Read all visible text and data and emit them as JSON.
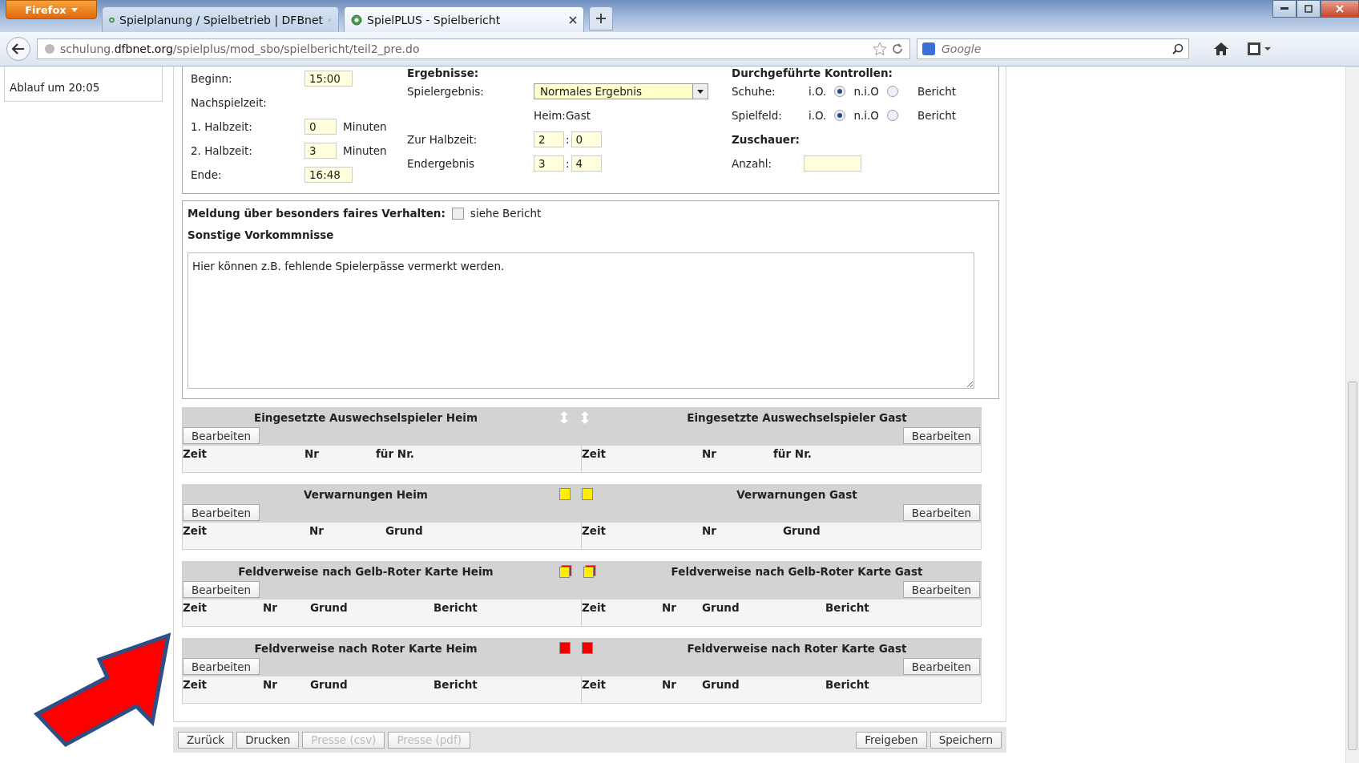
{
  "browser": {
    "menu_button": "Firefox",
    "tabs": [
      {
        "title": "Spielplanung / Spielbetrieb | DFBnet",
        "selected": false
      },
      {
        "title": "SpielPLUS - Spielbericht",
        "selected": true
      }
    ],
    "url_host": "schulung.",
    "url_domain": "dfbnet.org",
    "url_path": "/spielplus/mod_sbo/spielbericht/teil2_pre.do",
    "search_placeholder": "Google"
  },
  "sidebar": {
    "items": [
      "Ablauf um 20:05"
    ]
  },
  "times": [
    {
      "kind": "field",
      "label": "Beginn:",
      "value": "15:00"
    },
    {
      "kind": "label",
      "label": "Nachspielzeit:"
    },
    {
      "kind": "minutes",
      "label": "1. Halbzeit:",
      "value": "0",
      "unit": "Minuten"
    },
    {
      "kind": "minutes",
      "label": "2. Halbzeit:",
      "value": "3",
      "unit": "Minuten"
    },
    {
      "kind": "field",
      "label": "Ende:",
      "value": "16:48"
    }
  ],
  "results": {
    "heading": "Ergebnisse:",
    "result_label": "Spielergebnis:",
    "result_value": "Normales Ergebnis",
    "score_caption": "Heim:Gast",
    "scores": [
      {
        "label": "Zur Halbzeit:",
        "home": "2",
        "separator": ":",
        "guest": "0"
      },
      {
        "label": "Endergebnis",
        "home": "3",
        "separator": ":",
        "guest": "4"
      }
    ]
  },
  "checks": {
    "heading": "Durchgeführte Kontrollen:",
    "rows": [
      {
        "label": "Schuhe:",
        "options": [
          {
            "label": "i.O.",
            "selected": true
          },
          {
            "label": "n.i.O",
            "selected": false
          }
        ],
        "report": "Bericht"
      },
      {
        "label": "Spielfeld:",
        "options": [
          {
            "label": "i.O.",
            "selected": true
          },
          {
            "label": "n.i.O",
            "selected": false
          }
        ],
        "report": "Bericht"
      }
    ],
    "spectators_heading": "Zuschauer:",
    "count_label": "Anzahl:"
  },
  "fair_play": {
    "label": "Meldung über besonders faires Verhalten:",
    "checked": false,
    "checkbox_label": "siehe Bericht"
  },
  "incidents": {
    "heading": "Sonstige Vorkommnisse",
    "text": "Hier können z.B. fehlende Spielerpässe vermerkt werden."
  },
  "sections": [
    {
      "kind": "substitution",
      "home_title": "Eingesetzte Auswechselspieler Heim",
      "guest_title": "Eingesetzte Auswechselspieler Gast",
      "home_button": "Bearbeiten",
      "guest_button": "Bearbeiten",
      "home_columns": [
        "Zeit",
        "Nr",
        "für Nr."
      ],
      "guest_columns": [
        "Zeit",
        "Nr",
        "für Nr."
      ]
    },
    {
      "kind": "yellow",
      "home_title": "Verwarnungen Heim",
      "guest_title": "Verwarnungen Gast",
      "home_button": "Bearbeiten",
      "guest_button": "Bearbeiten",
      "home_columns": [
        "Zeit",
        "Nr",
        "Grund"
      ],
      "guest_columns": [
        "Zeit",
        "Nr",
        "Grund"
      ]
    },
    {
      "kind": "yellowred",
      "home_title": "Feldverweise nach Gelb-Roter Karte Heim",
      "guest_title": "Feldverweise nach Gelb-Roter Karte Gast",
      "home_button": "Bearbeiten",
      "guest_button": "Bearbeiten",
      "home_columns": [
        "Zeit",
        "Nr",
        "Grund",
        "Bericht"
      ],
      "guest_columns": [
        "Zeit",
        "Nr",
        "Grund",
        "Bericht"
      ]
    },
    {
      "kind": "red",
      "home_title": "Feldverweise nach Roter Karte Heim",
      "guest_title": "Feldverweise nach Roter Karte Gast",
      "home_button": "Bearbeiten",
      "guest_button": "Bearbeiten",
      "home_columns": [
        "Zeit",
        "Nr",
        "Grund",
        "Bericht"
      ],
      "guest_columns": [
        "Zeit",
        "Nr",
        "Grund",
        "Bericht"
      ]
    }
  ],
  "footer": {
    "left": [
      {
        "label": "Zurück",
        "disabled": false
      },
      {
        "label": "Drucken",
        "disabled": false
      },
      {
        "label": "Presse (csv)",
        "disabled": true
      },
      {
        "label": "Presse (pdf)",
        "disabled": true
      }
    ],
    "right": [
      {
        "label": "Freigeben",
        "disabled": false
      },
      {
        "label": "Speichern",
        "disabled": false
      }
    ]
  }
}
